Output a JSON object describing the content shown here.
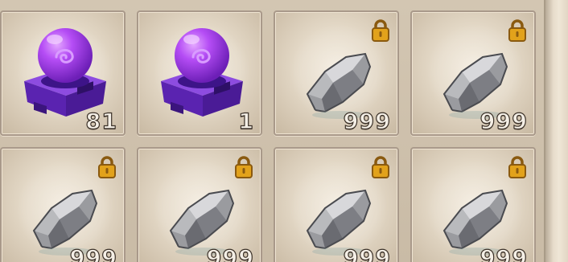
{
  "inventory": {
    "slots": [
      {
        "item": "purple-orb-on-pedestal",
        "count": "81",
        "locked": false
      },
      {
        "item": "purple-orb-on-pedestal",
        "count": "1",
        "locked": false
      },
      {
        "item": "grey-ore-stone",
        "count": "999",
        "locked": true
      },
      {
        "item": "grey-ore-stone",
        "count": "999",
        "locked": true
      },
      {
        "item": "grey-ore-stone",
        "count": "999",
        "locked": true
      },
      {
        "item": "grey-ore-stone",
        "count": "999",
        "locked": true
      },
      {
        "item": "grey-ore-stone",
        "count": "999",
        "locked": true
      },
      {
        "item": "grey-ore-stone",
        "count": "999",
        "locked": true
      }
    ]
  },
  "colors": {
    "orb": "#a23df0",
    "pedestal": "#6a2cc7",
    "lock": "#e2a21b",
    "count_text": "#f4efe6"
  }
}
